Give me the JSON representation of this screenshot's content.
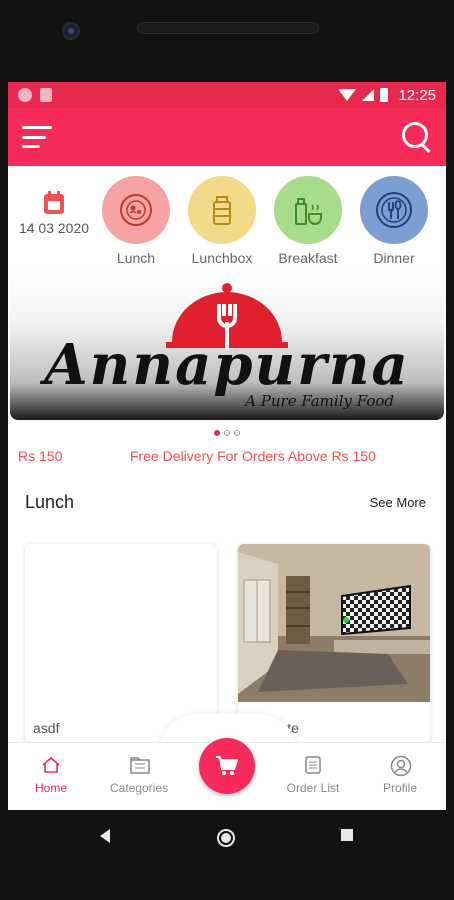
{
  "status_bar": {
    "time": "12:25"
  },
  "date": {
    "text": "14 03 2020"
  },
  "categories": [
    {
      "label": "Lunch",
      "color": "#f7a3a3",
      "icon": "food-plate-icon"
    },
    {
      "label": "Lunchbox",
      "color": "#f3d98a",
      "icon": "tiffin-icon"
    },
    {
      "label": "Breakfast",
      "color": "#a7dc8b",
      "icon": "breakfast-icon"
    },
    {
      "label": "Dinner",
      "color": "#7b9ed2",
      "icon": "cutlery-icon"
    }
  ],
  "banner": {
    "brand": "Annapurna",
    "tagline": "A Pure Family Food",
    "slide_count": 3,
    "active_slide": 1
  },
  "promo": {
    "price": "Rs 150",
    "message": "Free Delivery For Orders Above Rs 150"
  },
  "section": {
    "title": "Lunch",
    "see_more": "See More"
  },
  "items": [
    {
      "name": "asdf"
    },
    {
      "name": "riceplate"
    }
  ],
  "bottom_nav": {
    "home": "Home",
    "categories": "Categories",
    "order_list": "Order List",
    "profile": "Profile"
  },
  "colors": {
    "primary": "#f72b59",
    "status": "#e8294e",
    "promo": "#f0524f"
  }
}
